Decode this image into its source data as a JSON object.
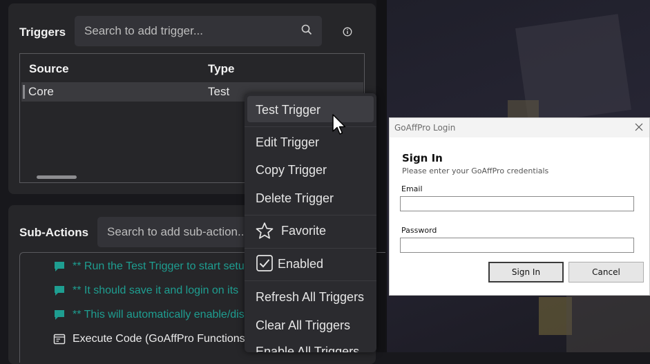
{
  "triggers": {
    "title": "Triggers",
    "search_placeholder": "Search to add trigger...",
    "columns": [
      "Source",
      "Type"
    ],
    "rows": [
      {
        "source": "Core",
        "type": "Test"
      }
    ]
  },
  "sub_actions": {
    "title": "Sub-Actions",
    "search_placeholder": "Search to add sub-action...",
    "items": [
      {
        "icon": "comment-icon",
        "text": "** Run the Test Trigger to start setu"
      },
      {
        "icon": "comment-icon",
        "text": "** It should save it and login on its"
      },
      {
        "icon": "comment-icon",
        "text": "** This will automatically enable/dis"
      },
      {
        "icon": "code-window-icon",
        "text": "Execute Code (GoAffPro Functions)"
      }
    ]
  },
  "context_menu": {
    "items": [
      "Test Trigger",
      "Edit Trigger",
      "Copy Trigger",
      "Delete Trigger",
      "Favorite",
      "Enabled",
      "Refresh All Triggers",
      "Clear All Triggers",
      "Enable All Triggers"
    ]
  },
  "login_dialog": {
    "window_title": "GoAffPro Login",
    "heading": "Sign In",
    "subtitle": "Please enter your GoAffPro credentials",
    "email_label": "Email",
    "email_value": "",
    "password_label": "Password",
    "password_value": "",
    "sign_in_label": "Sign In",
    "cancel_label": "Cancel"
  },
  "colors": {
    "panel": "#262629",
    "accent_teal": "#1e9e91",
    "menu_bg": "#2b2b2f"
  }
}
